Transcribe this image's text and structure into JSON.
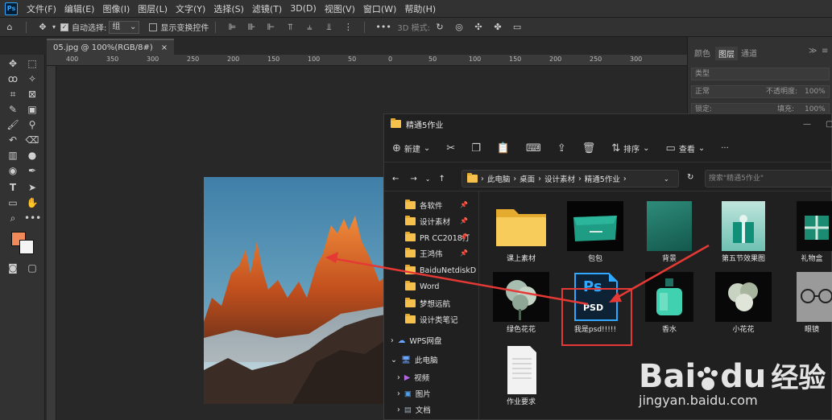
{
  "menubar": {
    "items": [
      "文件(F)",
      "编辑(E)",
      "图像(I)",
      "图层(L)",
      "文字(Y)",
      "选择(S)",
      "滤镜(T)",
      "3D(D)",
      "视图(V)",
      "窗口(W)",
      "帮助(H)"
    ]
  },
  "options": {
    "auto_select_label": "自动选择:",
    "auto_select_value": "组",
    "show_transform_label": "显示变换控件",
    "mode3d_label": "3D 模式:"
  },
  "document": {
    "tab_label": "05.jpg @ 100%(RGB/8#)",
    "close": "×"
  },
  "ruler": {
    "ticks": [
      "400",
      "350",
      "300",
      "250",
      "200",
      "150",
      "100",
      "50",
      "0",
      "50",
      "100",
      "150",
      "200",
      "250",
      "300",
      "350",
      "400",
      "450",
      "500"
    ]
  },
  "right_panel": {
    "tabs": [
      "颜色",
      "图层",
      "通道"
    ],
    "active_tab": "图层",
    "search_label": "类型",
    "mode_label": "正常",
    "opacity_label": "不透明度:",
    "opacity_value": "100%",
    "lock_label": "锁定:",
    "fill_label": "填充:",
    "fill_value": "100%"
  },
  "explorer": {
    "title": "精通5作业",
    "toolbar": {
      "new_label": "新建",
      "sort_label": "排序",
      "view_label": "查看",
      "more_label": "···"
    },
    "address": {
      "segments": [
        "此电脑",
        "桌面",
        "设计素材",
        "精通5作业"
      ],
      "search_placeholder": "搜索\"精通5作业\""
    },
    "nav": [
      {
        "label": "各软件",
        "pinned": true
      },
      {
        "label": "设计素材",
        "pinned": true
      },
      {
        "label": "PR CC2018打",
        "pinned": true
      },
      {
        "label": "王鸿伟",
        "pinned": true
      },
      {
        "label": "BaiduNetdiskD",
        "pinned": false
      },
      {
        "label": "Word",
        "pinned": false
      },
      {
        "label": "梦想远航",
        "pinned": false
      },
      {
        "label": "设计类笔记",
        "pinned": false
      }
    ],
    "nav_roots": [
      {
        "label": "WPS网盘"
      },
      {
        "label": "此电脑"
      },
      {
        "label": "视频"
      },
      {
        "label": "图片"
      },
      {
        "label": "文档"
      }
    ],
    "files": [
      {
        "name": "课上素材",
        "kind": "folder"
      },
      {
        "name": "包包",
        "kind": "image"
      },
      {
        "name": "背景",
        "kind": "image"
      },
      {
        "name": "第五节效果图",
        "kind": "image"
      },
      {
        "name": "礼物盒",
        "kind": "image"
      },
      {
        "name": "绿色花花",
        "kind": "image"
      },
      {
        "name": "我是psd!!!!!",
        "kind": "psd",
        "selected": true
      },
      {
        "name": "香水",
        "kind": "image"
      },
      {
        "name": "小花花",
        "kind": "image"
      },
      {
        "name": "眼镜",
        "kind": "image"
      },
      {
        "name": "作业要求",
        "kind": "document"
      }
    ],
    "psd_icon": {
      "top": "Ps",
      "bottom": "PSD"
    }
  },
  "watermark": {
    "brand": "Bai",
    "paw": "du",
    "cn": "经验",
    "url": "jingyan.baidu.com"
  },
  "colors": {
    "accent_red": "#e53935",
    "ps_blue": "#31a8ff",
    "folder": "#f5c14c",
    "fg_color": "#f08a5a"
  }
}
